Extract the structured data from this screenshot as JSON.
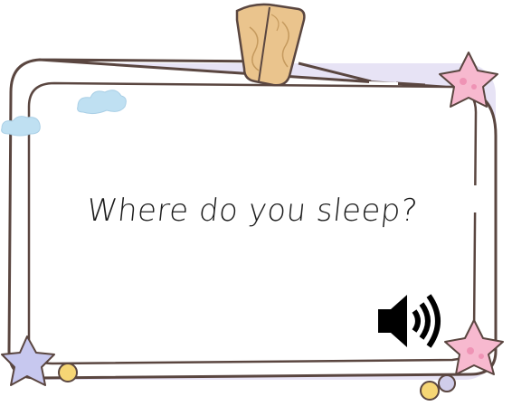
{
  "card": {
    "prompt": "Where do you sleep?",
    "audio_icon": "speaker-volume-icon"
  },
  "colors": {
    "frame_outline": "#5a4640",
    "frame_shadow": "#d9d4ee",
    "clip_wood": "#e9c38a",
    "star_pink": "#f7b9cf",
    "star_lavender": "#c7c8ef",
    "cloud_blue": "#bfe0f2",
    "dot_yellow": "#f6d675",
    "dot_lavender": "#d0cdea",
    "text": "#1b1b1b"
  }
}
